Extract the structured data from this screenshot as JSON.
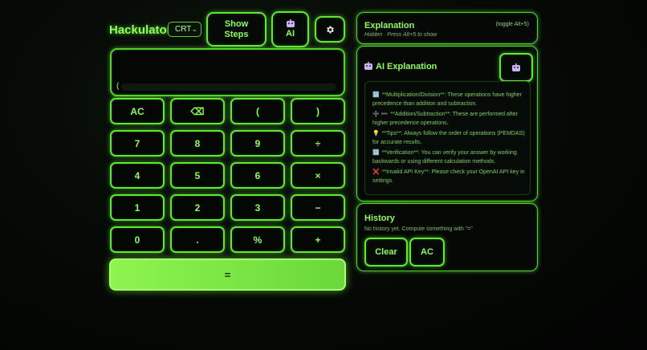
{
  "header": {
    "app_title": "Hackulator",
    "theme_select": "CRT",
    "show_steps_line1": "Show",
    "show_steps_line2": "Steps",
    "ai_label": "AI",
    "settings_icon": "gear-icon"
  },
  "display": {
    "expression": "("
  },
  "keys": {
    "row1": [
      "AC",
      "⌫",
      "(",
      ")"
    ],
    "row2": [
      "7",
      "8",
      "9",
      "÷"
    ],
    "row3": [
      "4",
      "5",
      "6",
      "×"
    ],
    "row4": [
      "1",
      "2",
      "3",
      "−"
    ],
    "row5": [
      "0",
      ".",
      "%",
      "+"
    ],
    "equals": "="
  },
  "explanation": {
    "title": "Explanation",
    "toggle": "(toggle Alt+5)",
    "hint": "Hidden · Press Alt+5 to show"
  },
  "ai_explanation": {
    "title": "AI Explanation",
    "items": [
      {
        "icon": "🔢",
        "text": "**Multiplication/Division**: These operations have higher precedence than addition and subtraction."
      },
      {
        "icon": "➕ ➖",
        "text": "**Addition/Subtraction**: These are performed after higher precedence operations."
      },
      {
        "icon": "💡",
        "text": "**Tips**: Always follow the order of operations (PEMDAS) for accurate results."
      },
      {
        "icon": "🔢",
        "text": "**Verification**: You can verify your answer by working backwards or using different calculation methods."
      },
      {
        "icon": "❌",
        "text": "**Invalid API Key**: Please check your OpenAI API key in settings."
      }
    ]
  },
  "history": {
    "title": "History",
    "empty": "No history yet. Compute something with \"=\"",
    "clear_label": "Clear",
    "ac_label": "AC"
  }
}
